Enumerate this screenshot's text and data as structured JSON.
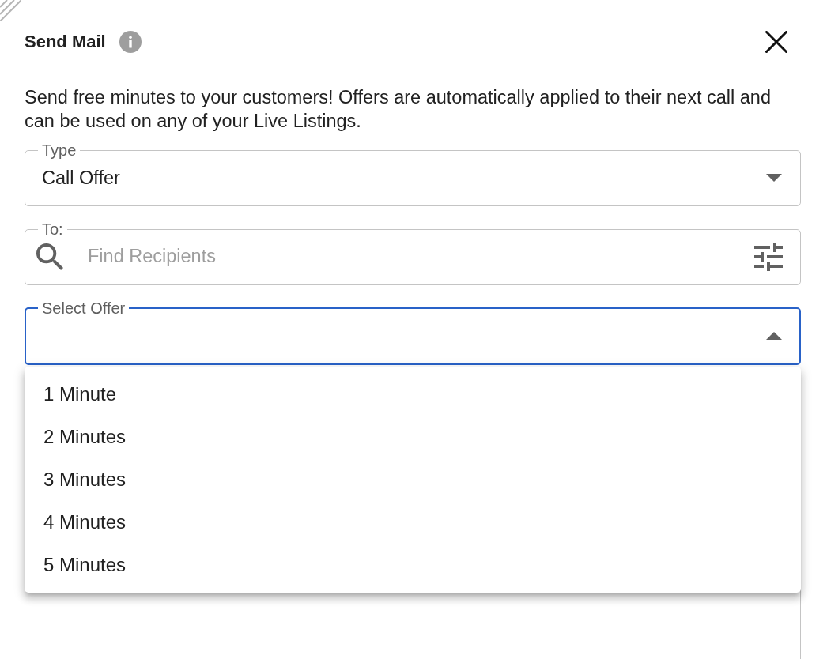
{
  "dialog": {
    "title": "Send Mail",
    "description": "Send free minutes to your customers! Offers are automatically applied to their next call and can be used on any of your Live Listings.",
    "fields": [
      {
        "kind": "select",
        "label": "Type",
        "value": "Call Offer",
        "expanded": false
      },
      {
        "kind": "search",
        "label": "To:",
        "placeholder": "Find Recipients"
      },
      {
        "kind": "select",
        "label": "Select Offer",
        "expanded": true,
        "options": [
          {
            "label": "1 Minute",
            "selected": false
          },
          {
            "label": "2 Minutes",
            "selected": false
          },
          {
            "label": "3 Minutes",
            "selected": false
          },
          {
            "label": "4 Minutes",
            "selected": false
          },
          {
            "label": "5 Minutes",
            "selected": false
          }
        ]
      },
      {
        "kind": "textarea"
      }
    ]
  }
}
